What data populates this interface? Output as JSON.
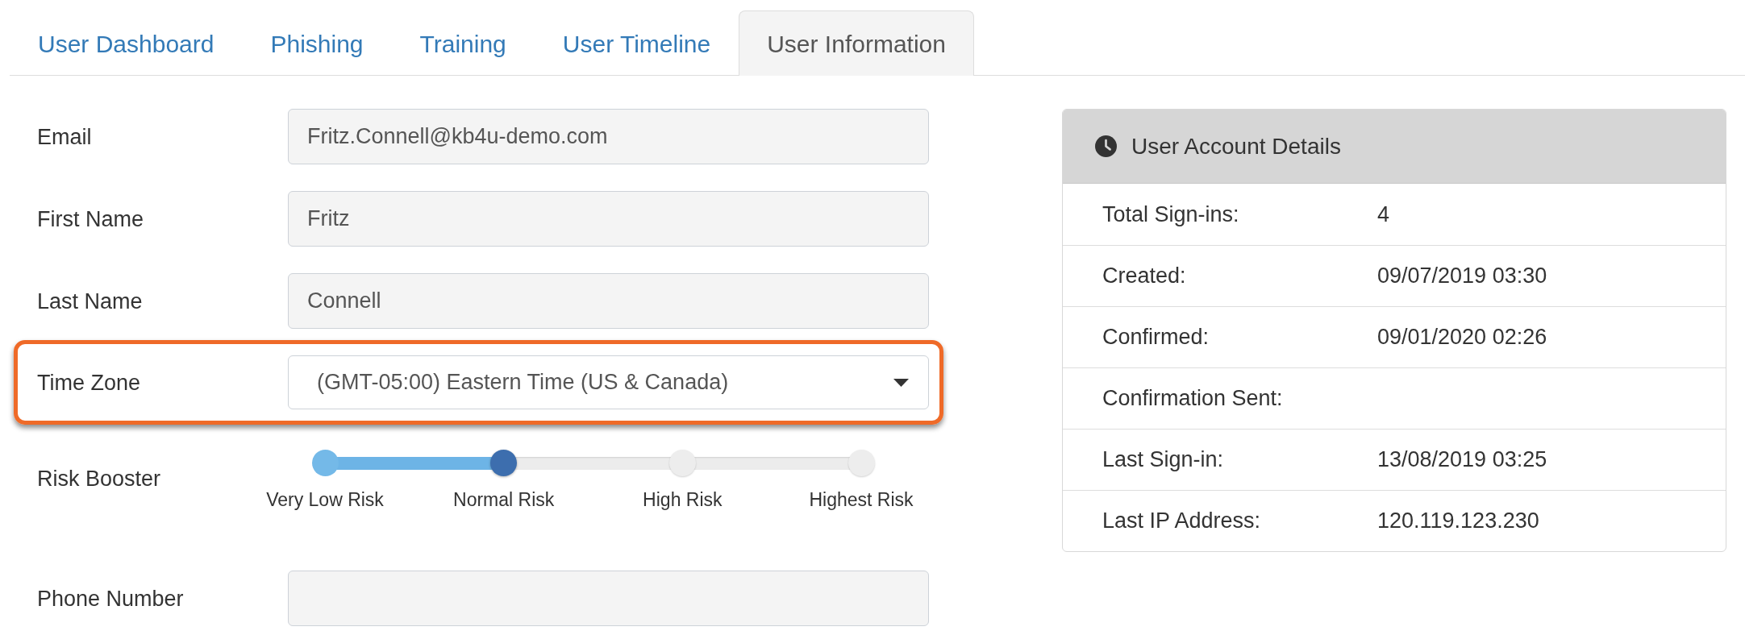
{
  "tabs": [
    {
      "label": "User Dashboard",
      "selected": false
    },
    {
      "label": "Phishing",
      "selected": false
    },
    {
      "label": "Training",
      "selected": false
    },
    {
      "label": "User Timeline",
      "selected": false
    },
    {
      "label": "User Information",
      "selected": true
    }
  ],
  "form": {
    "fields": [
      {
        "kind": "input",
        "label": "Email",
        "value": "Fritz.Connell@kb4u-demo.com",
        "highlighted": false
      },
      {
        "kind": "input",
        "label": "First Name",
        "value": "Fritz",
        "highlighted": false
      },
      {
        "kind": "input",
        "label": "Last Name",
        "value": "Connell",
        "highlighted": false
      },
      {
        "kind": "select",
        "label": "Time Zone",
        "value": "(GMT-05:00) Eastern Time (US & Canada)",
        "highlighted": true
      },
      {
        "kind": "slider",
        "label": "Risk Booster",
        "level": 0.3333,
        "ticks": [
          "Very Low Risk",
          "Normal Risk",
          "High Risk",
          "Highest Risk"
        ],
        "highlighted": false
      },
      {
        "kind": "input",
        "label": "Phone Number",
        "highlighted": false
      }
    ]
  },
  "account_details": {
    "title": "User Account Details",
    "rows": [
      {
        "label": "Total Sign-ins:",
        "value": "4"
      },
      {
        "label": "Created:",
        "value": "09/07/2019 03:30"
      },
      {
        "label": "Confirmed:",
        "value": "09/01/2020 02:26"
      },
      {
        "label": "Confirmation Sent:"
      },
      {
        "label": "Last Sign-in:",
        "value": "13/08/2019 03:25"
      },
      {
        "label": "Last IP Address:",
        "value": "120.119.123.230"
      }
    ]
  }
}
